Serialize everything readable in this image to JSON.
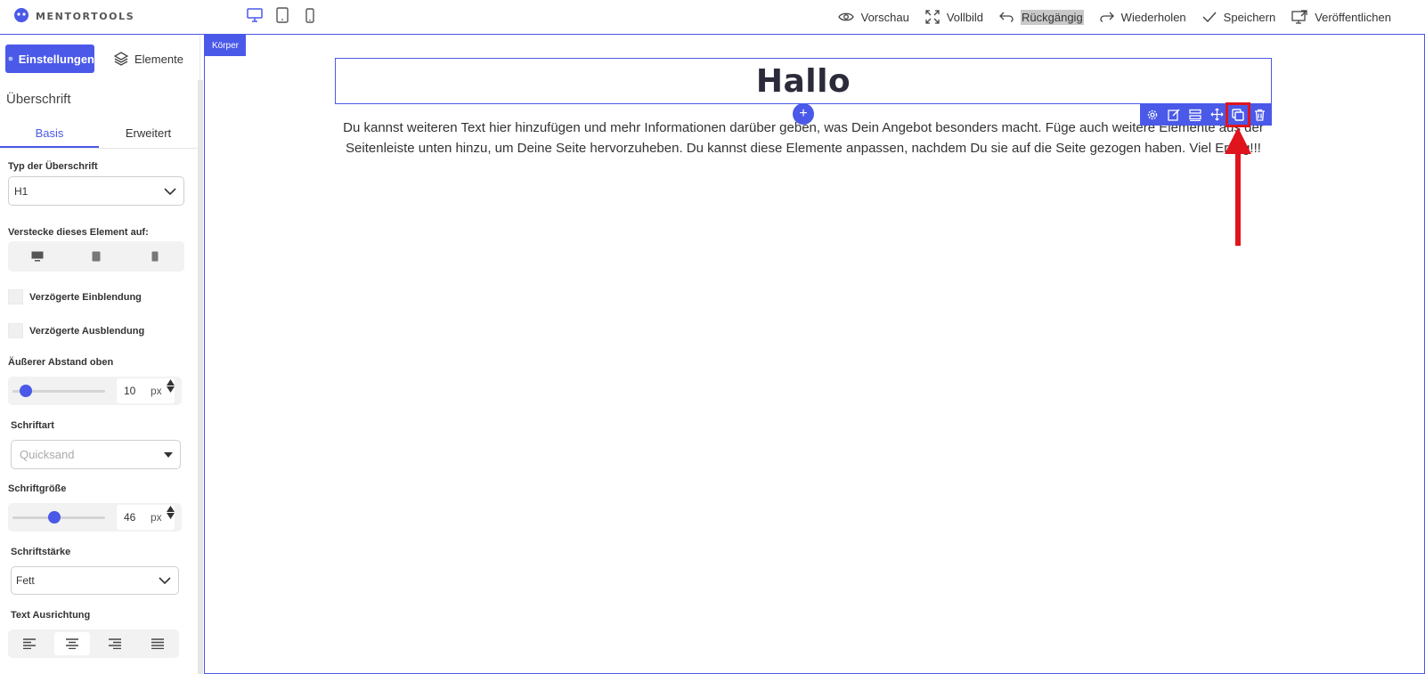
{
  "brand": {
    "name": "MENTORTOOLS"
  },
  "topbar": {
    "devices": [
      "desktop-icon",
      "tablet-icon",
      "mobile-icon"
    ],
    "actions": {
      "preview": "Vorschau",
      "fullscreen": "Vollbild",
      "undo": "Rückgängig",
      "redo": "Wiederholen",
      "save": "Speichern",
      "publish": "Veröffentlichen"
    }
  },
  "sidebar": {
    "tab_settings": "Einstellungen",
    "tab_elements": "Elemente",
    "section_title": "Überschrift",
    "subtab_basic": "Basis",
    "subtab_advanced": "Erweitert",
    "heading_type_label": "Typ der Überschrift",
    "heading_type_value": "H1",
    "hide_label": "Verstecke dieses Element auf:",
    "delayed_show": "Verzögerte Einblendung",
    "delayed_hide": "Verzögerte Ausblendung",
    "margin_top_label": "Äußerer Abstand oben",
    "margin_top_value": "10",
    "margin_top_unit": "px",
    "margin_top_slider": 0.14,
    "font_label": "Schriftart",
    "font_placeholder": "Quicksand",
    "font_size_label": "Schriftgröße",
    "font_size_value": "46",
    "font_size_unit": "px",
    "font_size_slider": 0.45,
    "font_weight_label": "Schriftstärke",
    "font_weight_value": "Fett",
    "align_label": "Text Ausrichtung",
    "align_active": "center"
  },
  "canvas": {
    "body_tag": "Körper",
    "heading": "Hallo",
    "add_button": "+",
    "paragraph": "Du kannst weiteren Text hier hinzufügen und mehr Informationen darüber geben, was Dein Angebot besonders macht. Füge auch weitere Elemente aus der Seitenleiste unten hinzu, um Deine Seite hervorzuheben. Du kannst diese Elemente anpassen, nachdem Du sie auf die Seite gezogen haben. Viel Erfolg!!!",
    "toolbar_icons": [
      "gear-icon",
      "edit-icon",
      "layout-icon",
      "move-icon",
      "duplicate-icon",
      "trash-icon"
    ]
  },
  "colors": {
    "accent": "#4a59e8",
    "annotation": "#e0141c"
  }
}
